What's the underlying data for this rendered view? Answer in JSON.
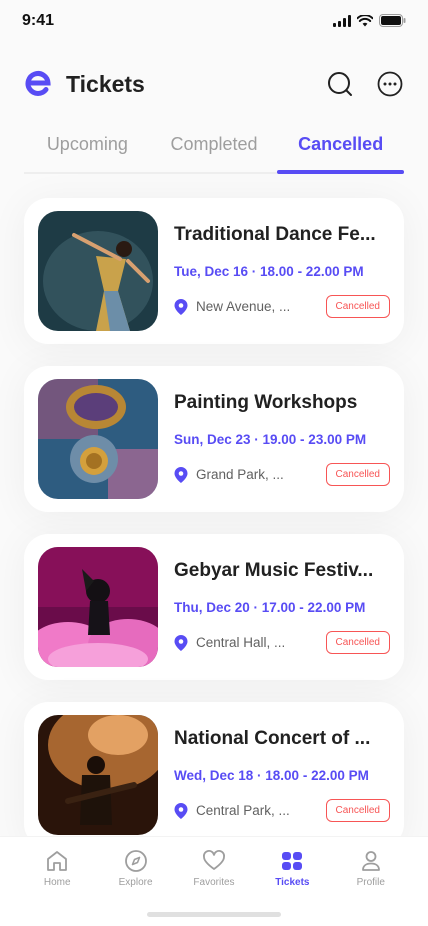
{
  "status_bar": {
    "time": "9:41"
  },
  "header": {
    "title": "Tickets"
  },
  "tabs": [
    {
      "label": "Upcoming",
      "active": false
    },
    {
      "label": "Completed",
      "active": false
    },
    {
      "label": "Cancelled",
      "active": true
    }
  ],
  "tickets": [
    {
      "title": "Traditional Dance Fe...",
      "date": "Tue, Dec 16 · 18.00 - 22.00 PM",
      "location": "New Avenue, ...",
      "status": "Cancelled"
    },
    {
      "title": "Painting Workshops",
      "date": "Sun, Dec 23 · 19.00 - 23.00 PM",
      "location": "Grand Park, ...",
      "status": "Cancelled"
    },
    {
      "title": "Gebyar Music Festiv...",
      "date": "Thu, Dec 20 · 17.00 - 22.00 PM",
      "location": "Central Hall, ...",
      "status": "Cancelled"
    },
    {
      "title": "National Concert of ...",
      "date": "Wed, Dec 18 · 18.00 - 22.00 PM",
      "location": "Central Park, ...",
      "status": "Cancelled"
    }
  ],
  "bottom_nav": [
    {
      "label": "Home",
      "icon": "home-icon",
      "active": false
    },
    {
      "label": "Explore",
      "icon": "compass-icon",
      "active": false
    },
    {
      "label": "Favorites",
      "icon": "heart-icon",
      "active": false
    },
    {
      "label": "Tickets",
      "icon": "ticket-icon",
      "active": true
    },
    {
      "label": "Profile",
      "icon": "profile-icon",
      "active": false
    }
  ],
  "colors": {
    "accent": "#584CF4",
    "cancelled": "#F75555"
  }
}
